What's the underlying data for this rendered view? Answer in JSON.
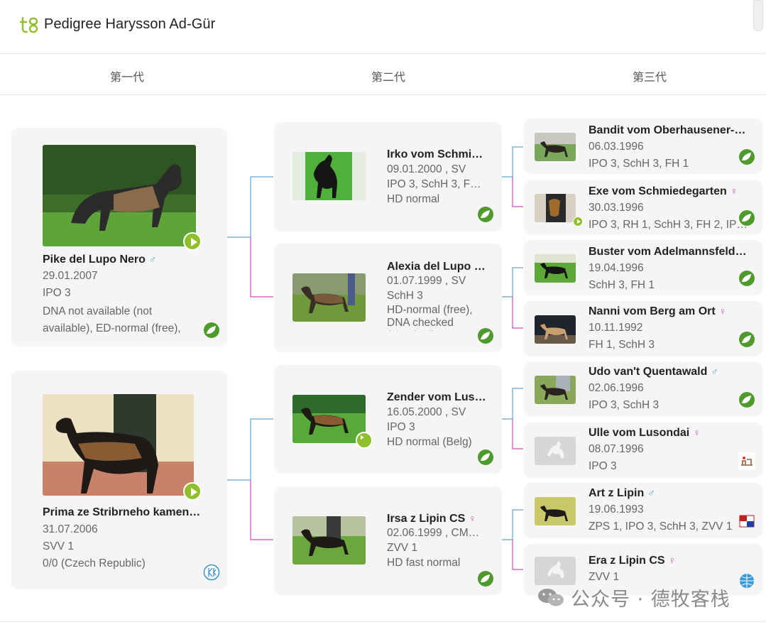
{
  "header": {
    "title": "Pedigree Harysson Ad-Gür"
  },
  "tabs": [
    "第一代",
    "第二代",
    "第三代"
  ],
  "colors": {
    "accent_green": "#8fbf2a",
    "male": "#4aa3d8",
    "female": "#d44bc6",
    "line_blue": "#5aa6d6",
    "line_pink": "#d54bc4"
  },
  "gen1": [
    {
      "name": "Pike del Lupo Nero",
      "sex": "♂",
      "date": "29.01.2007",
      "titles": "IPO 3",
      "health": "DNA not available (not available), ED-normal (free),",
      "icon": "leaf-icon"
    },
    {
      "name": "Prima ze Stribrneho kamen…",
      "sex": "",
      "date": "31.07.2006",
      "titles": "SVV 1",
      "health": "0/0 (Czech Republic)",
      "icon": "kk-club-icon"
    }
  ],
  "gen2": [
    {
      "name": "Irko vom Schmi…",
      "sex": "",
      "date": "09.01.2000 , SV",
      "titles": "IPO 3, SchH 3, F…",
      "health": "HD normal",
      "icon": "leaf-icon"
    },
    {
      "name": "Alexia del Lupo …",
      "sex": "",
      "date": "01.07.1999 , SV",
      "titles": "SchH 3",
      "health": "HD-normal (free), DNA checked (checked)",
      "icon": "leaf-icon"
    },
    {
      "name": "Zender vom Lus…",
      "sex": "",
      "date": "16.05.2000 , SV",
      "titles": "IPO 3",
      "health": "HD normal (Belg)",
      "icon": "leaf-icon"
    },
    {
      "name": "Irsa z Lipin CS",
      "sex": "♀",
      "date": "02.06.1999 , CM…",
      "titles": "ZVV 1",
      "health": "HD fast normal",
      "icon": "leaf-icon"
    }
  ],
  "gen3": [
    {
      "name": "Bandit vom Oberhausener-Kr…",
      "sex": "",
      "date": "06.03.1996",
      "titles": "IPO 3, SchH 3, FH 1",
      "icon": "leaf-icon"
    },
    {
      "name": "Exe vom Schmiedegarten",
      "sex": "♀",
      "date": "30.03.1996",
      "titles": "IPO 3, RH 1, SchH 3, FH 2, IPO…",
      "icon": "leaf-icon"
    },
    {
      "name": "Buster vom Adelmannsfelder…",
      "sex": "",
      "date": "19.04.1996",
      "titles": "SchH 3, FH 1",
      "icon": "leaf-icon"
    },
    {
      "name": "Nanni vom Berg am Ort",
      "sex": "♀",
      "date": "10.11.1992",
      "titles": "FH 1, SchH 3",
      "icon": "leaf-icon"
    },
    {
      "name": "Udo van't Quentawald",
      "sex": "♂",
      "date": "02.06.1996",
      "titles": "IPO 3, SchH 3",
      "icon": "leaf-icon"
    },
    {
      "name": "Ulle vom Lusondai",
      "sex": "♀",
      "date": "08.07.1996",
      "titles": "IPO 3",
      "icon": "club-logo-icon"
    },
    {
      "name": "Art z Lipin",
      "sex": "♂",
      "date": "19.06.1993",
      "titles": "ZPS 1, IPO 3, SchH 3, ZVV 1",
      "icon": "flag-icon"
    },
    {
      "name": "Era z Lipin CS",
      "sex": "♀",
      "date": "",
      "titles": "ZVV 1",
      "icon": "globe-icon"
    }
  ],
  "watermark": "公众号 · 德牧客栈"
}
